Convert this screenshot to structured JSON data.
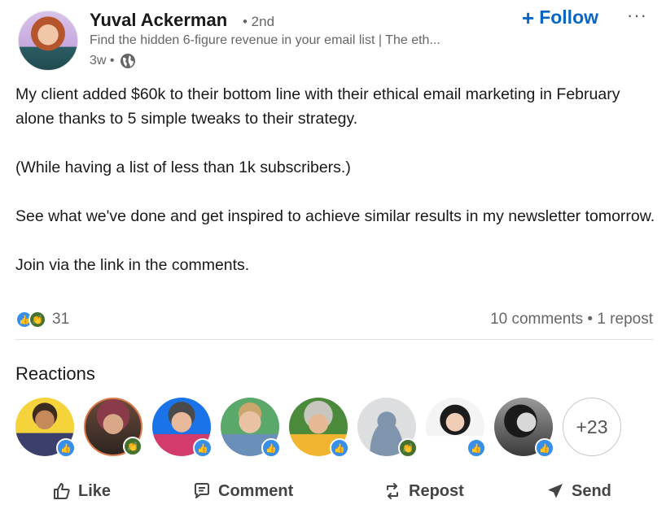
{
  "author": {
    "name": "Yuval Ackerman",
    "degree": "• 2nd",
    "headline": "Find the hidden 6-figure revenue in your email list | The eth...",
    "time": "3w •"
  },
  "follow": {
    "label": "Follow",
    "icon": "plus-icon"
  },
  "post": {
    "para1": "My client added $60k to their bottom line with their ethical email marketing in February alone thanks to 5 simple tweaks to their strategy.",
    "para2": "(While having a list of less than 1k subscribers.)",
    "para3": "See what we've done and get inspired to achieve similar results in my newsletter tomorrow.",
    "para4": "Join via the link in the comments."
  },
  "social": {
    "reaction_count": "31",
    "comments_reposts": "10 comments • 1 repost"
  },
  "reactions": {
    "title": "Reactions",
    "more": "+23",
    "people": [
      {
        "reaction": "like"
      },
      {
        "reaction": "celebrate"
      },
      {
        "reaction": "like"
      },
      {
        "reaction": "like"
      },
      {
        "reaction": "like"
      },
      {
        "reaction": "celebrate"
      },
      {
        "reaction": "like"
      },
      {
        "reaction": "like"
      }
    ]
  },
  "actions": {
    "like": "Like",
    "comment": "Comment",
    "repost": "Repost",
    "send": "Send"
  },
  "colors": {
    "accent": "#0a66c2",
    "like_badge": "#378fe9",
    "celebrate_badge": "#44712e"
  }
}
